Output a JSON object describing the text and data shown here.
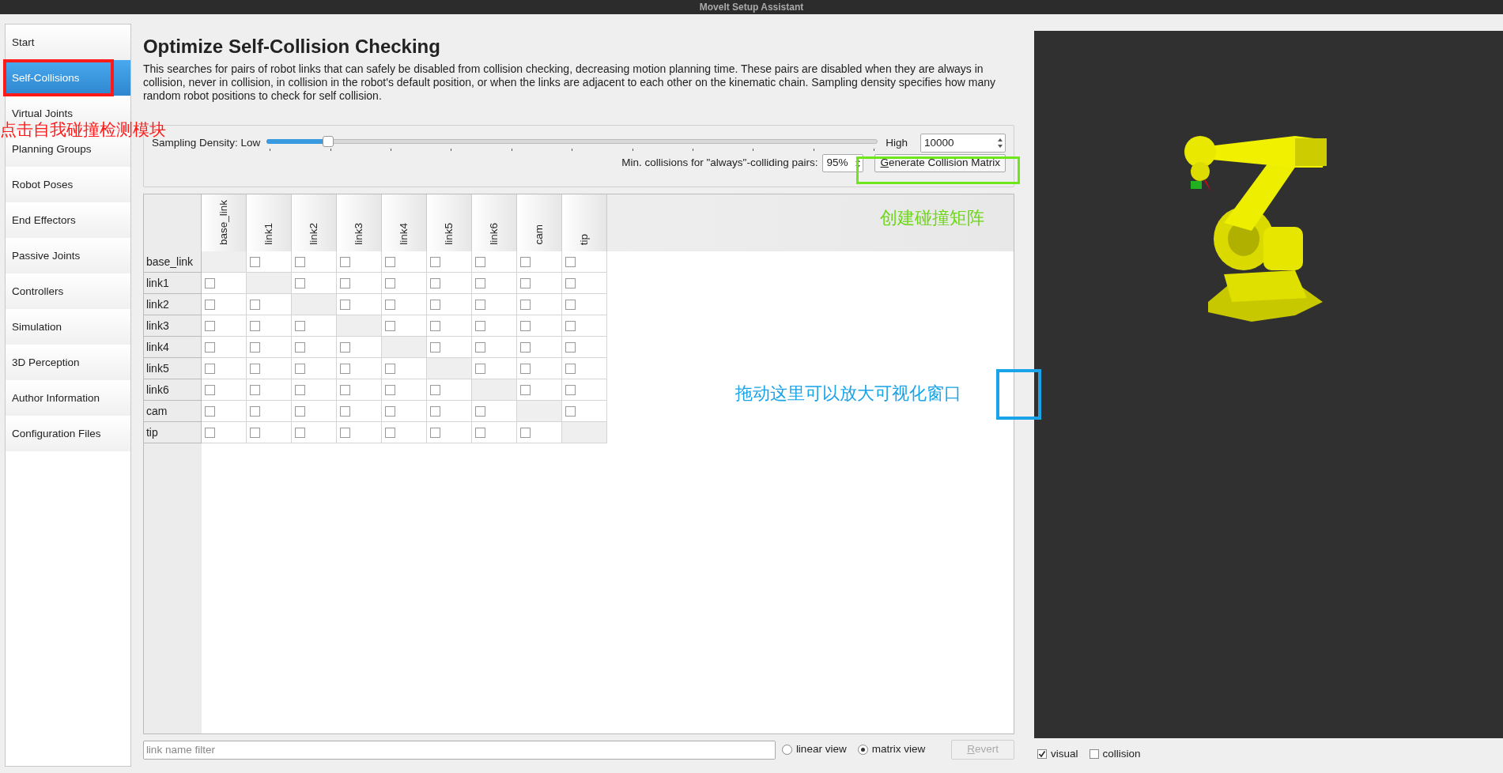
{
  "window": {
    "title": "MoveIt Setup Assistant"
  },
  "sidebar": {
    "items": [
      {
        "label": "Start",
        "selected": false
      },
      {
        "label": "Self-Collisions",
        "selected": true
      },
      {
        "label": "Virtual Joints",
        "selected": false
      },
      {
        "label": "Planning Groups",
        "selected": false
      },
      {
        "label": "Robot Poses",
        "selected": false
      },
      {
        "label": "End Effectors",
        "selected": false
      },
      {
        "label": "Passive Joints",
        "selected": false
      },
      {
        "label": "Controllers",
        "selected": false
      },
      {
        "label": "Simulation",
        "selected": false
      },
      {
        "label": "3D Perception",
        "selected": false
      },
      {
        "label": "Author Information",
        "selected": false
      },
      {
        "label": "Configuration Files",
        "selected": false
      }
    ]
  },
  "page": {
    "title": "Optimize Self-Collision Checking",
    "description": "This searches for pairs of robot links that can safely be disabled from collision checking, decreasing motion planning time. These pairs are disabled when they are always in collision, never in collision, in collision in the robot's default position, or when the links are adjacent to each other on the kinematic chain. Sampling density specifies how many random robot positions to check for self collision."
  },
  "sampling": {
    "label": "Sampling Density: Low",
    "high_label": "High",
    "level": 0.1,
    "value": "10000"
  },
  "min_collisions": {
    "label": "Min. collisions for \"always\"-colliding pairs:",
    "value": "95%"
  },
  "generate_button": {
    "label": "Generate Collision Matrix"
  },
  "matrix": {
    "columns": [
      "base_link",
      "link1",
      "link2",
      "link3",
      "link4",
      "link5",
      "link6",
      "cam",
      "tip"
    ],
    "rows": [
      {
        "label": "base_link",
        "checked": [
          false,
          false,
          false,
          false,
          false,
          false,
          false,
          false
        ]
      },
      {
        "label": "link1",
        "checked": [
          false,
          false,
          false,
          false,
          false,
          false,
          false,
          false
        ]
      },
      {
        "label": "link2",
        "checked": [
          false,
          false,
          false,
          false,
          false,
          false,
          false,
          false
        ]
      },
      {
        "label": "link3",
        "checked": [
          false,
          false,
          false,
          false,
          false,
          false,
          false,
          false
        ]
      },
      {
        "label": "link4",
        "checked": [
          false,
          false,
          false,
          false,
          false,
          false,
          false,
          false
        ]
      },
      {
        "label": "link5",
        "checked": [
          false,
          false,
          false,
          false,
          false,
          false,
          false,
          false
        ]
      },
      {
        "label": "link6",
        "checked": [
          false,
          false,
          false,
          false,
          false,
          false,
          false,
          false
        ]
      },
      {
        "label": "cam",
        "checked": [
          false,
          false,
          false,
          false,
          false,
          false,
          false,
          false
        ]
      },
      {
        "label": "tip",
        "checked": [
          false,
          false,
          false,
          false,
          false,
          false,
          false,
          false
        ]
      }
    ]
  },
  "filter": {
    "placeholder": "link name filter"
  },
  "view_options": [
    {
      "label": "linear view",
      "selected": false
    },
    {
      "label": "matrix view",
      "selected": true
    }
  ],
  "revert_button": {
    "label": "Revert",
    "disabled": true
  },
  "viewer": {
    "options": [
      {
        "label": "visual",
        "checked": true
      },
      {
        "label": "collision",
        "checked": false
      }
    ]
  },
  "annotations": [
    {
      "kind": "box",
      "color": "#ff1a1a"
    },
    {
      "kind": "text",
      "text": "点击自我碰撞检测模块",
      "color": "#ff1a1a"
    },
    {
      "kind": "box",
      "color": "#6ee619"
    },
    {
      "kind": "text",
      "text": "创建碰撞矩阵",
      "color": "#6ed619"
    },
    {
      "kind": "text",
      "text": "拖动这里可以放大可视化窗口",
      "color": "#1aa3e8"
    },
    {
      "kind": "box",
      "color": "#1aa3e8"
    }
  ]
}
